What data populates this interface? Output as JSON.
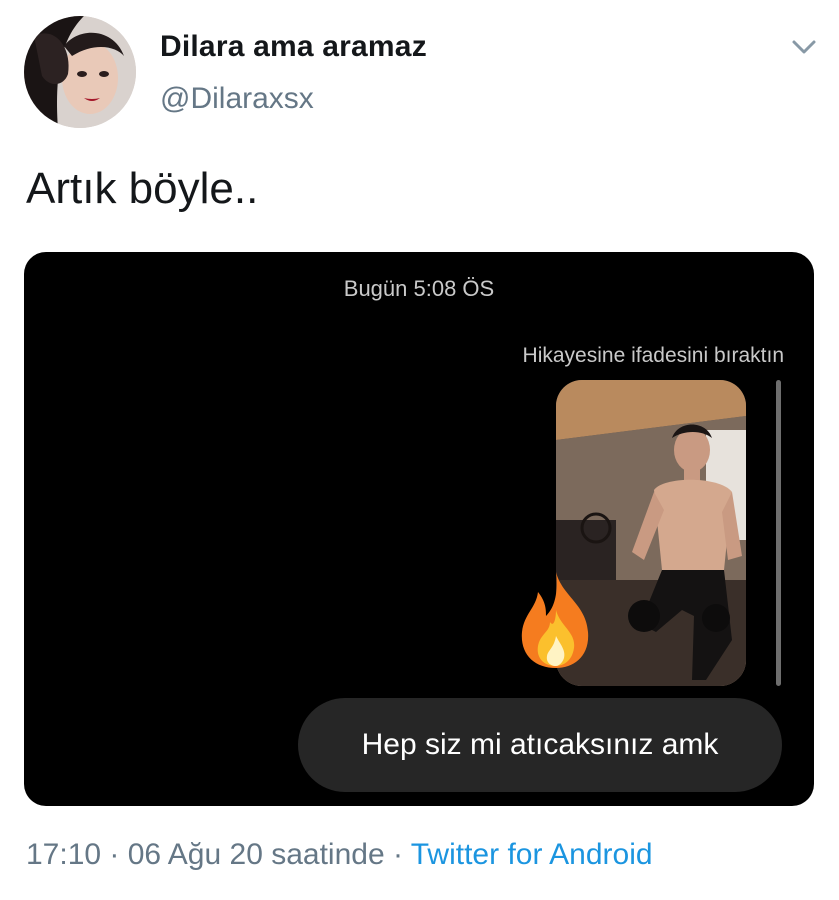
{
  "author": {
    "display_name": "Dilara ama aramaz",
    "handle": "@Dilaraxsx",
    "avatar_icon": "profile-photo"
  },
  "tweet": {
    "text": "Artık böyle.."
  },
  "media": {
    "dm_timestamp": "Bugün 5:08 ÖS",
    "story_reaction_note": "Hikayesine  ifadesini bıraktın",
    "reaction_icon": "fire-emoji",
    "message": "Hep siz mi atıcaksınız amk"
  },
  "meta": {
    "time": "17:10",
    "separator1": " · ",
    "date": "06 Ağu 20 saatinde",
    "separator2": " · ",
    "source": "Twitter for Android"
  },
  "colors": {
    "link": "#1b95e0",
    "muted": "#657786",
    "bubble": "#262626"
  }
}
